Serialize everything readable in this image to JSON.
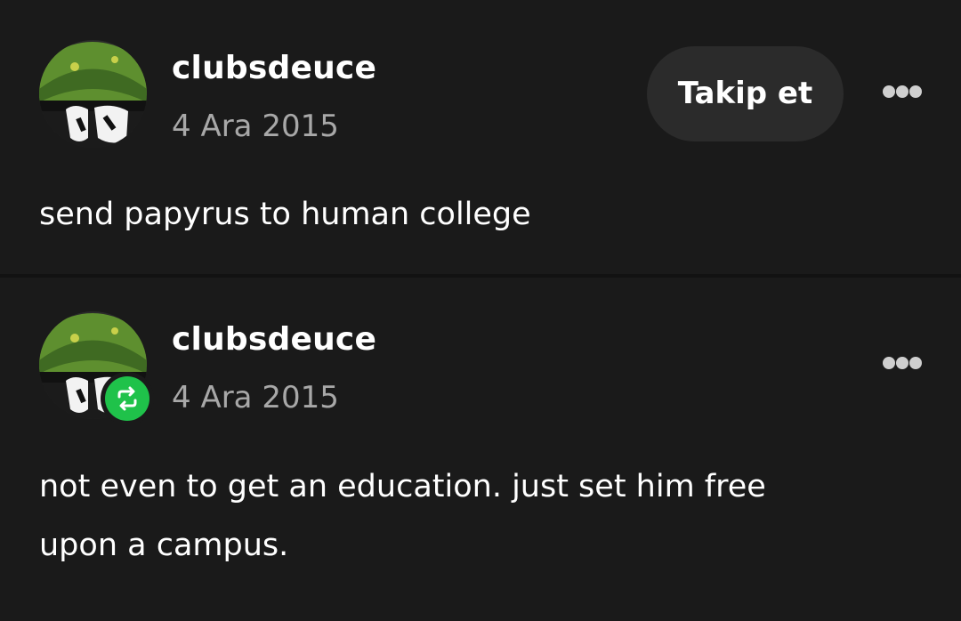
{
  "posts": [
    {
      "username": "clubsdeuce",
      "date": "4 Ara 2015",
      "follow_label": "Takip et",
      "body": "send papyrus to human college"
    },
    {
      "username": "clubsdeuce",
      "date": "4 Ara 2015",
      "reblogged": true,
      "body_lines": [
        "not even to get an education. just set him free",
        "upon a campus."
      ]
    }
  ],
  "icons": {
    "more": "more-options-icon",
    "reblog": "reblog-icon"
  },
  "colors": {
    "background": "#1a1a1a",
    "follow_button_bg": "#2b2b2b",
    "reblog_badge": "#1fc24a",
    "timestamp": "#a8a8a8"
  }
}
